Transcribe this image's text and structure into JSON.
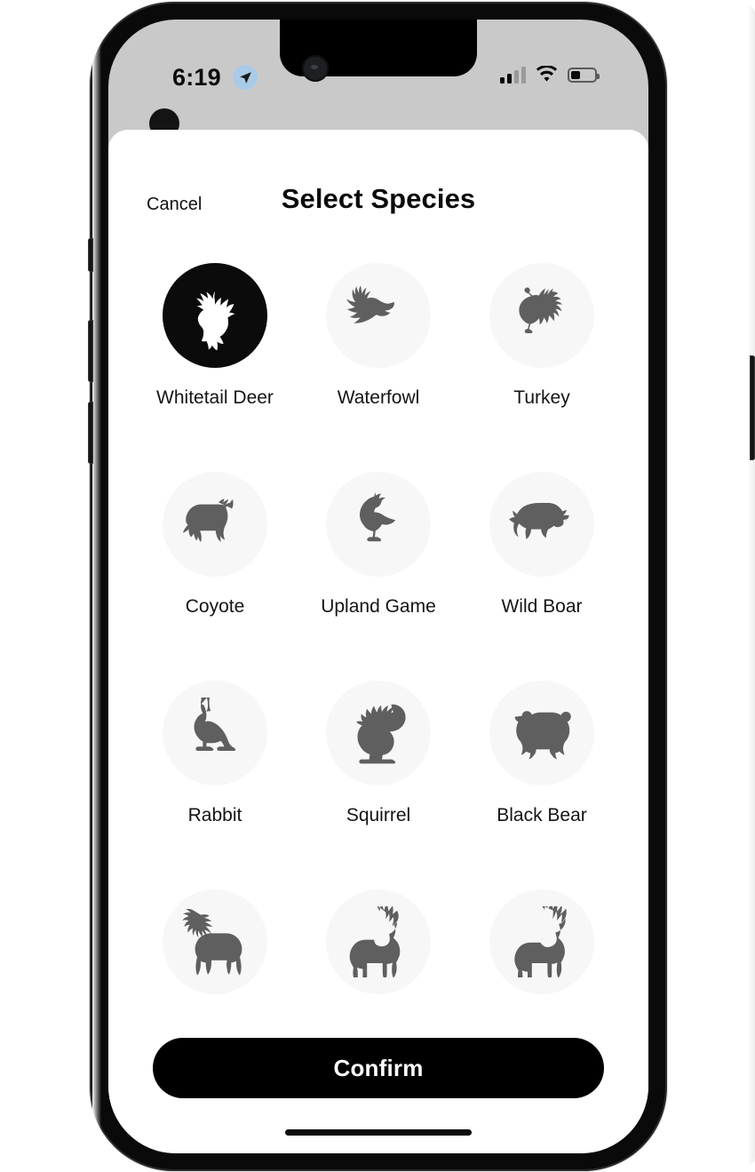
{
  "status_bar": {
    "time": "6:19",
    "location_icon": "location-arrow-icon",
    "cellular_icon": "cellular-signal-icon",
    "cellular_bars_active": 2,
    "cellular_bars_total": 4,
    "wifi_icon": "wifi-icon",
    "battery_icon": "battery-icon",
    "battery_percent": 38
  },
  "header": {
    "cancel_label": "Cancel",
    "title": "Select Species"
  },
  "colors": {
    "selected_background": "#0b0b0b",
    "unselected_background": "#f7f7f7",
    "icon_fill": "#5f5f5f",
    "selected_icon_fill": "#ffffff",
    "confirm_background": "#000000",
    "confirm_text": "#ffffff",
    "status_bar_background": "#c9c9c9",
    "location_badge": "#a9cbe8"
  },
  "species": [
    {
      "id": "whitetail-deer",
      "label": "Whitetail Deer",
      "icon": "deer-head-icon",
      "selected": true
    },
    {
      "id": "waterfowl",
      "label": "Waterfowl",
      "icon": "flying-duck-icon",
      "selected": false
    },
    {
      "id": "turkey",
      "label": "Turkey",
      "icon": "turkey-icon",
      "selected": false
    },
    {
      "id": "coyote",
      "label": "Coyote",
      "icon": "coyote-icon",
      "selected": false
    },
    {
      "id": "upland-game",
      "label": "Upland Game",
      "icon": "quail-icon",
      "selected": false
    },
    {
      "id": "wild-boar",
      "label": "Wild Boar",
      "icon": "boar-icon",
      "selected": false
    },
    {
      "id": "rabbit",
      "label": "Rabbit",
      "icon": "rabbit-icon",
      "selected": false
    },
    {
      "id": "squirrel",
      "label": "Squirrel",
      "icon": "squirrel-icon",
      "selected": false
    },
    {
      "id": "black-bear",
      "label": "Black Bear",
      "icon": "bear-icon",
      "selected": false
    },
    {
      "id": "moose",
      "label": "",
      "icon": "moose-icon",
      "selected": false
    },
    {
      "id": "mule-deer",
      "label": "",
      "icon": "mule-deer-icon",
      "selected": false
    },
    {
      "id": "elk",
      "label": "",
      "icon": "elk-icon",
      "selected": false
    }
  ],
  "footer": {
    "confirm_label": "Confirm"
  }
}
